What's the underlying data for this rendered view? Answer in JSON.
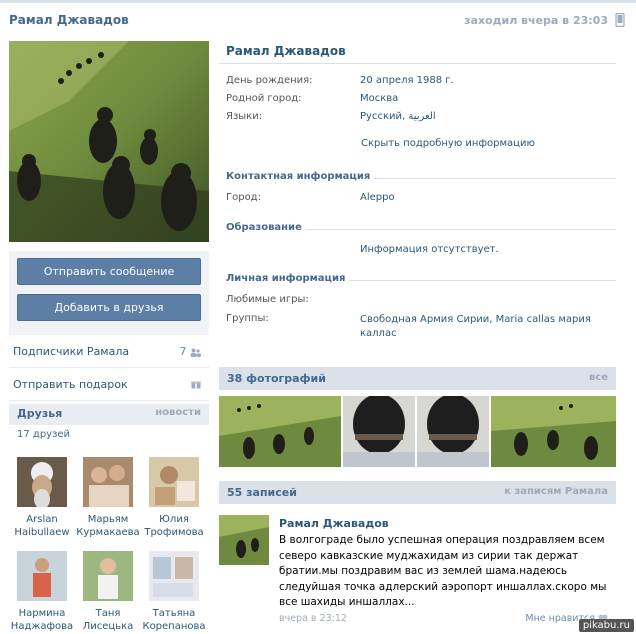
{
  "header": {
    "name": "Рамал Джавадов",
    "last_seen": "заходил вчера в 23:03"
  },
  "actions": {
    "send_message": "Отправить сообщение",
    "add_friend": "Добавить в друзья"
  },
  "sidebar": {
    "subscribers_label": "Подписчики Рамала",
    "subscribers_count": "7",
    "gift_label": "Отправить подарок"
  },
  "friends": {
    "title": "Друзья",
    "news_link": "новости",
    "count": "17 друзей",
    "items": [
      {
        "first": "Arslan",
        "last": "Haibullaew"
      },
      {
        "first": "Марьям",
        "last": "Курмакаева"
      },
      {
        "first": "Юлия",
        "last": "Трофимова"
      },
      {
        "first": "Нармина",
        "last": "Наджафова"
      },
      {
        "first": "Таня",
        "last": "Лисецька"
      },
      {
        "first": "Татьяна",
        "last": "Корепанова"
      }
    ]
  },
  "profile": {
    "name": "Рамал Джавадов",
    "birthday_label": "День рождения:",
    "birthday": "20 апреля 1988 г.",
    "hometown_label": "Родной город:",
    "hometown": "Москва",
    "languages_label": "Языки:",
    "languages": "Русский, العربية",
    "hide_info": "Скрыть подробную информацию",
    "contact_title": "Контактная информация",
    "city_label": "Город:",
    "city": "Aleppo",
    "education_title": "Образование",
    "education_missing": "Информация отсутствует.",
    "personal_title": "Личная информация",
    "games_label": "Любимые игры:",
    "groups_label": "Группы:",
    "groups": "Свободная Армия Сирии, Maria callas мария каллас"
  },
  "photos": {
    "title": "38 фотографий",
    "all_link": "все"
  },
  "wall": {
    "title": "55 записей",
    "link": "к записям Рамала",
    "post": {
      "author": "Рамал Джавадов",
      "text": "В волгограде было успешная операция поздравляем всем северо кавказские муджахидам из сирии так держат братии.мы поздравим вас из землей шама.надеюсь следуйшая точка адлерский аэропорт иншаллах.скоро мы все шахиды иншаллах...",
      "time": "вчера в 23:12",
      "like": "Мне нравится"
    }
  },
  "watermark": "pikabu.ru",
  "colors": {
    "accent": "#45688e",
    "link": "#2b587a",
    "button": "#5d7fa6",
    "bar": "#dae1e8"
  }
}
